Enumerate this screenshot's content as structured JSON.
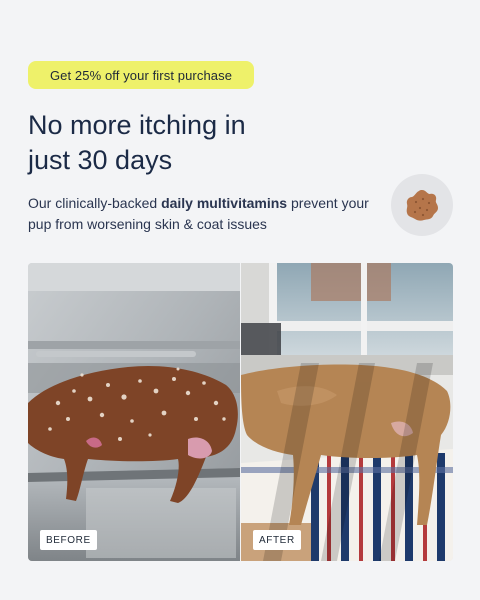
{
  "promo": {
    "label": "Get 25% off your first purchase"
  },
  "headline": {
    "line1": "No more itching in",
    "line2": "just 30 days"
  },
  "subcopy": {
    "part1": "Our clinically-backed ",
    "highlight": "daily multivitamins",
    "part2": " prevent your pup from worsening skin & coat issues"
  },
  "photos": {
    "before_label": "BEFORE",
    "after_label": "AFTER"
  },
  "colors": {
    "background": "#f3f4f6",
    "promo_bg": "#eef16a",
    "text": "#1b2a46",
    "chew": "#b5754a"
  },
  "icons": {
    "badge": "paw-shaped-chew-icon"
  }
}
